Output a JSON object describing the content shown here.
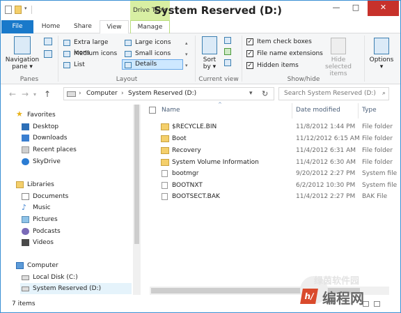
{
  "window": {
    "title": "System Reserved (D:)",
    "context_tab": "Drive Tools",
    "min": "—",
    "max": "□",
    "close": "✕"
  },
  "tabs": [
    "File",
    "Home",
    "Share",
    "View",
    "Manage"
  ],
  "ribbon": {
    "panes": {
      "nav_pane": "Navigation",
      "nav_pane2": "pane ▾",
      "label": "Panes"
    },
    "layout": {
      "options": [
        "Extra large icons",
        "Large icons",
        "Medium icons",
        "Small icons",
        "List",
        "Details"
      ],
      "selected": "Details",
      "label": "Layout"
    },
    "current_view": {
      "sort_by": "Sort",
      "sort_by2": "by ▾",
      "label": "Current view"
    },
    "show_hide": {
      "item_check_boxes": "Item check boxes",
      "file_name_extensions": "File name extensions",
      "hidden_items": "Hidden items",
      "hide_selected_items": "Hide selected",
      "hide_selected_items2": "items",
      "label": "Show/hide"
    },
    "options": {
      "label": "Options",
      "label2": "▾"
    }
  },
  "address": {
    "crumbs": [
      "Computer",
      "System Reserved (D:)"
    ],
    "search_placeholder": "Search System Reserved (D:)"
  },
  "sidebar": {
    "favorites": "Favorites",
    "favorites_items": [
      "Desktop",
      "Downloads",
      "Recent places",
      "SkyDrive"
    ],
    "libraries": "Libraries",
    "libraries_items": [
      "Documents",
      "Music",
      "Pictures",
      "Podcasts",
      "Videos"
    ],
    "computer": "Computer",
    "computer_items": [
      "Local Disk (C:)",
      "System Reserved (D:)"
    ]
  },
  "columns": {
    "name": "Name",
    "date": "Date modified",
    "type": "Type"
  },
  "files": [
    {
      "name": "$RECYCLE.BIN",
      "date": "11/8/2012 1:44 PM",
      "type": "File folder",
      "icon": "folder"
    },
    {
      "name": "Boot",
      "date": "11/12/2012 6:15 AM",
      "type": "File folder",
      "icon": "folder"
    },
    {
      "name": "Recovery",
      "date": "11/4/2012 6:31 AM",
      "type": "File folder",
      "icon": "folder"
    },
    {
      "name": "System Volume Information",
      "date": "11/4/2012 6:30 AM",
      "type": "File folder",
      "icon": "folder"
    },
    {
      "name": "bootmgr",
      "date": "9/20/2012 2:27 PM",
      "type": "System file",
      "icon": "file"
    },
    {
      "name": "BOOTNXT",
      "date": "6/2/2012 10:30 PM",
      "type": "System file",
      "icon": "file"
    },
    {
      "name": "BOOTSECT.BAK",
      "date": "11/4/2012 2:27 PM",
      "type": "BAK File",
      "icon": "file"
    }
  ],
  "status": {
    "count": "7 items"
  },
  "watermark": {
    "line1": "绿茵软件园",
    "line2": "编程网"
  },
  "colors": {
    "accent": "#1979ca",
    "context": "#d8efa3",
    "close": "#c7312b",
    "folder": "#f4cf6b"
  }
}
